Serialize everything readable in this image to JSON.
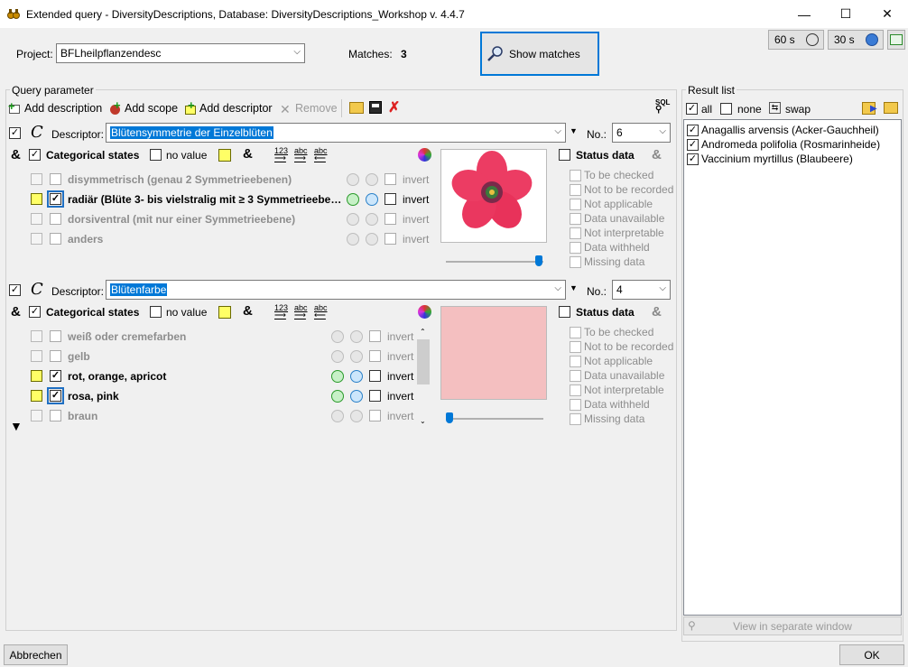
{
  "window": {
    "title": "Extended query - DiversityDescriptions,  Database: DiversityDescriptions_Workshop    v. 4.4.7",
    "minimize": "—",
    "maximize": "☐",
    "close": "✕"
  },
  "top": {
    "project_label": "Project:",
    "project_value": "BFLheilpflanzendesc",
    "matches_label": "Matches:",
    "matches_value": "3",
    "show_matches": "Show matches",
    "timer1": "60 s",
    "timer2": "30 s"
  },
  "query": {
    "group_label": "Query parameter",
    "toolbar": {
      "add_description": "Add description",
      "add_scope": "Add scope",
      "add_descriptor": "Add descriptor",
      "remove": "Remove"
    },
    "blocks": [
      {
        "descriptor_label": "Descriptor:",
        "descriptor_value": "Blütensymmetrie der Einzelblüten",
        "no_label": "No.:",
        "no_value": "6",
        "and_symbol": "&",
        "categorical_label": "Categorical states",
        "no_value_label": "no value",
        "status_label": "Status data",
        "states": [
          {
            "label": "disymmetrisch (genau 2 Symmetrieebenen)",
            "checked": false,
            "active": false
          },
          {
            "label": "radiär (Blüte 3- bis vielstralig mit ≥ 3 Symmetrieebe…",
            "checked": true,
            "active": true
          },
          {
            "label": "dorsiventral (mit nur einer Symmetrieebene)",
            "checked": false,
            "active": false
          },
          {
            "label": "anders",
            "checked": false,
            "active": false
          }
        ],
        "invert_label": "invert",
        "slider_fraction": 1.0
      },
      {
        "descriptor_label": "Descriptor:",
        "descriptor_value": "Blütenfarbe",
        "no_label": "No.:",
        "no_value": "4",
        "and_symbol": "&",
        "categorical_label": "Categorical states",
        "no_value_label": "no value",
        "status_label": "Status data",
        "states": [
          {
            "label": "weiß oder cremefarben",
            "checked": false,
            "active": false
          },
          {
            "label": "gelb",
            "checked": false,
            "active": false
          },
          {
            "label": "rot, orange, apricot",
            "checked": true,
            "active": true
          },
          {
            "label": "rosa, pink",
            "checked": true,
            "active": true
          },
          {
            "label": "braun",
            "checked": false,
            "active": false
          }
        ],
        "invert_label": "invert",
        "slider_fraction": 0.0,
        "swatch_color": "#f4bfc0"
      }
    ],
    "status_items": [
      "To be checked",
      "Not to be recorded",
      "Not applicable",
      "Data unavailable",
      "Not interpretable",
      "Data withheld",
      "Missing data"
    ]
  },
  "results": {
    "group_label": "Result list",
    "all_label": "all",
    "none_label": "none",
    "swap_label": "swap",
    "items": [
      "Anagallis arvensis (Acker-Gauchheil)",
      "Andromeda polifolia (Rosmarinheide)",
      "Vaccinium myrtillus (Blaubeere)"
    ],
    "view_separate": "View in separate window"
  },
  "footer": {
    "cancel": "Abbrechen",
    "ok": "OK"
  },
  "colors": {
    "highlight": "#0078d7",
    "flower": "#e8325a",
    "swatch": "#f4bfc0"
  }
}
